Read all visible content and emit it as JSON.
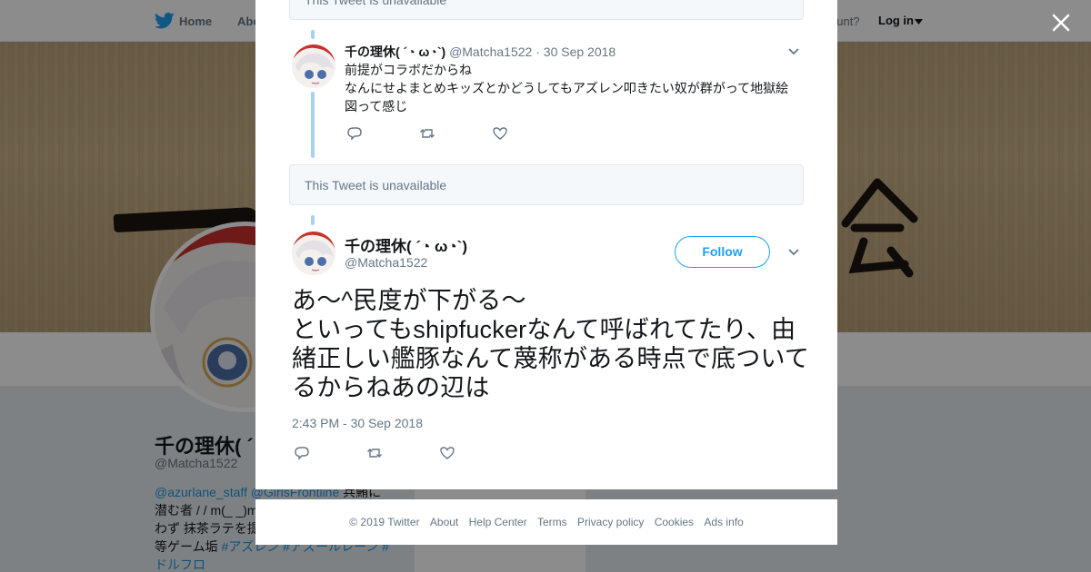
{
  "nav": {
    "home": "Home",
    "about": "Abo",
    "account_prompt": "ccount?",
    "login": "Log in"
  },
  "profile": {
    "name": "千の理休( ´◔ ω◔`)",
    "handle": "@Matcha1522",
    "bio_lines": [
      {
        "link1": "@azurlane_staff",
        "link2": "@GirlsFrontline",
        "rest": " 兵鮪に"
      },
      {
        "text": "潜む者 / / m(_ _)m"
      },
      {
        "text": "わず 抹茶ラテを提"
      },
      {
        "pre": "等ゲーム垢 ",
        "link": "#アズレン #アズールレーン #"
      },
      {
        "link": "ドルフロ"
      }
    ],
    "card_text": "Ads info"
  },
  "modal": {
    "unavailable_top": "This Tweet is unavailable",
    "reply_tweet": {
      "name": "千の理休( ´◔ ω◔`)",
      "handle": "@Matcha1522",
      "separator": "·",
      "date": "30 Sep 2018",
      "lines": [
        "前提がコラボだからね",
        "なんにせよまとめキッズとかどうしてもアズレン叩きたい奴が群がって地獄絵図って感じ"
      ]
    },
    "unavailable_middle": "This Tweet is unavailable",
    "main_tweet": {
      "name": "千の理休( ´◔ ω◔`)",
      "handle": "@Matcha1522",
      "follow_label": "Follow",
      "lines": [
        "あ～^民度が下がる～",
        "といってもshipfuckerなんて呼ばれてたり、由緒正しい艦豚なんて蔑称がある時点で底ついてるからねあの辺は"
      ],
      "timestamp": "2:43 PM - 30 Sep 2018"
    }
  },
  "footer": {
    "links": [
      "© 2019 Twitter",
      "About",
      "Help Center",
      "Terms",
      "Privacy policy",
      "Cookies",
      "Ads info"
    ]
  },
  "colors": {
    "brand_blue": "#1da1f2",
    "thread_line": "#a6d2f0",
    "muted_text": "#657786",
    "link_blue": "#1b95e0"
  },
  "icons": [
    "twitter-bird-icon",
    "close-icon",
    "chevron-down-icon",
    "reply-icon",
    "retweet-icon",
    "like-icon",
    "caret-down-icon"
  ]
}
